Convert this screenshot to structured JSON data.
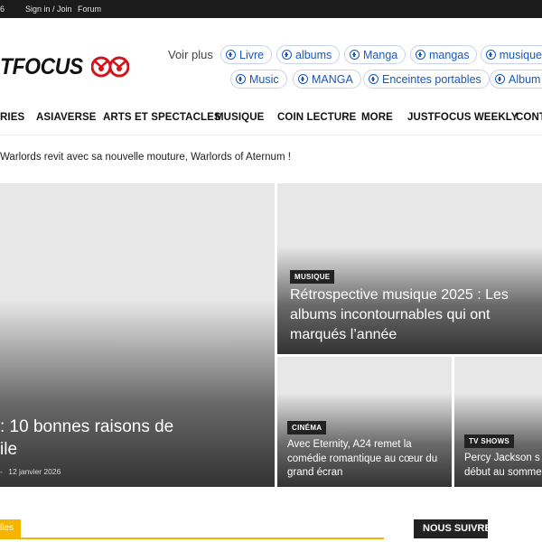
{
  "topbar": {
    "date": "6",
    "sign_in": "Sign in / Join",
    "forum": "Forum"
  },
  "logo": {
    "text": "TFOCUS",
    "accent_color": "#d0151b"
  },
  "tags": {
    "voir_plus": "Voir plus",
    "row1": [
      "Livre",
      "albums",
      "Manga",
      "mangas",
      "musique"
    ],
    "row2": [
      "Music",
      "MANGA",
      "Enceintes portables",
      "Album"
    ]
  },
  "nav": {
    "items": [
      "RIES",
      "ASIAVERSE",
      "ARTS ET SPECTACLES",
      "MUSIQUE",
      "COIN LECTURE",
      "MORE",
      "JUSTFOCUS WEEKLY",
      "CONT"
    ]
  },
  "ticker": {
    "text": "Warlords revit avec sa nouvelle mouture, Warlords of Aternum !"
  },
  "hero": {
    "main": {
      "title_line1": ": 10 bonnes raisons de",
      "title_line2": "ile",
      "meta_sep": "-",
      "date": "12 janvier 2026"
    },
    "top_right": {
      "category": "MUSIQUE",
      "title_line1": "Rétrospective musique 2025 : Les",
      "title_line2": "albums incontournables qui ont",
      "title_line3": "marqués l’année"
    },
    "bottom_mid": {
      "category": "CINÉMA",
      "title_line1": "Avec Eternity, A24 remet la",
      "title_line2": "comédie romantique au cœur du",
      "title_line3": "grand écran"
    },
    "bottom_right": {
      "category": "TV SHOWS",
      "title_line1": "Percy Jackson s",
      "title_line2": "début au somme"
    }
  },
  "bottom": {
    "section_tag": "lles",
    "follow": "NOUS SUIVRE"
  }
}
